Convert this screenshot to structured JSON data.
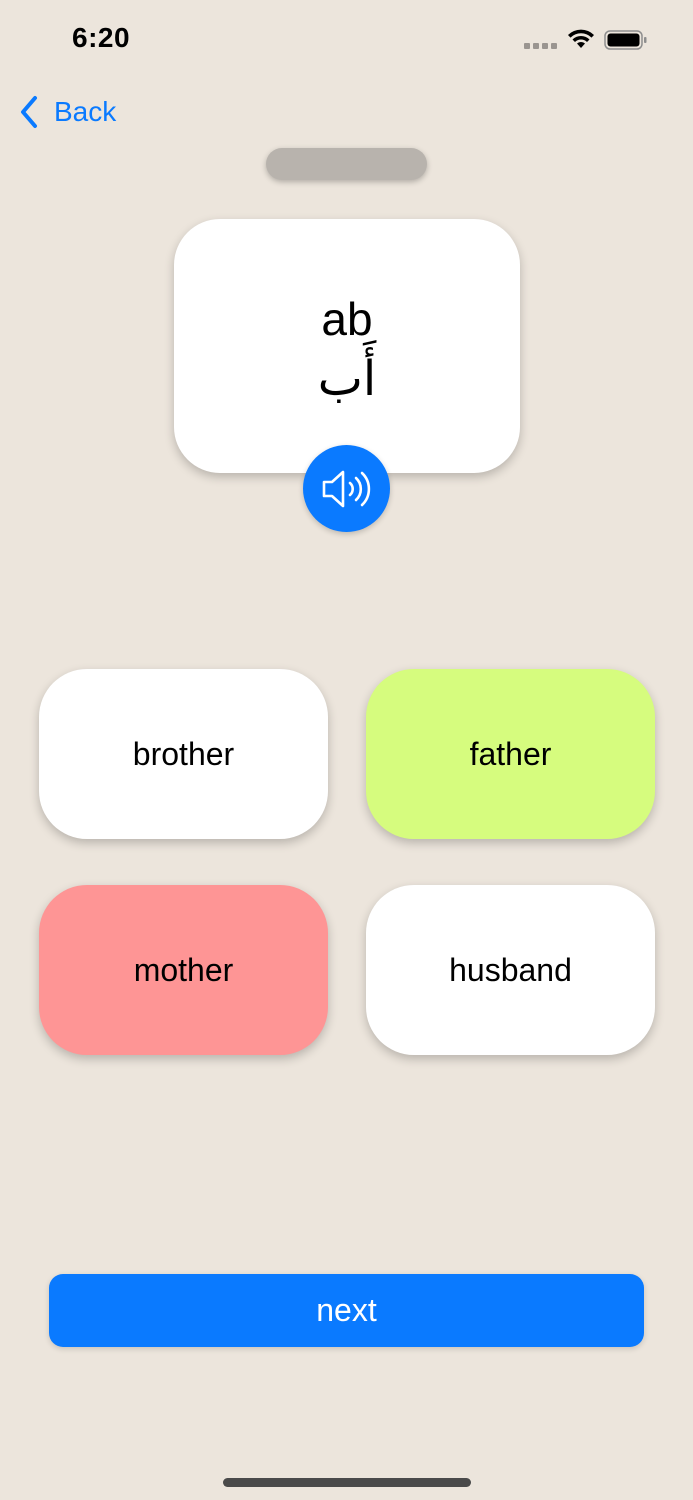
{
  "status_bar": {
    "time": "6:20"
  },
  "nav": {
    "back_label": "Back",
    "accent": "#0a7aff"
  },
  "card": {
    "latin": "ab",
    "arabic": "أَب"
  },
  "options": [
    {
      "label": "brother",
      "state": "default",
      "color": "#ffffff"
    },
    {
      "label": "father",
      "state": "correct",
      "color": "#d6fc7e"
    },
    {
      "label": "mother",
      "state": "incorrect",
      "color": "#fe9595"
    },
    {
      "label": "husband",
      "state": "default",
      "color": "#ffffff"
    }
  ],
  "next_label": "next",
  "icons": {
    "back": "chevron-left-icon",
    "speaker": "speaker-wave-icon",
    "wifi": "wifi-icon",
    "battery": "battery-icon",
    "signal": "signal-icon"
  }
}
